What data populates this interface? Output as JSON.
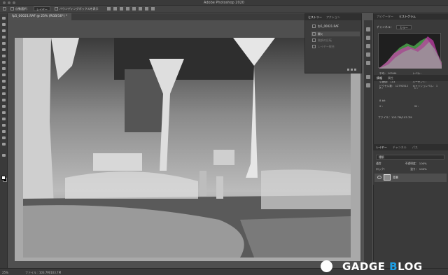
{
  "app": {
    "title": "Adobe Photoshop 2020"
  },
  "options_bar": {
    "auto_select_label": "自動選択：",
    "layer_select_value": "レイヤー",
    "bounding_box_label": "バウンディングボックスを表示"
  },
  "document": {
    "tab_title": "fp5_00021.RAF @ 25% (RGB/16*) *"
  },
  "status": {
    "zoom": "25%",
    "file_info": "ファイル : 103.7M/103.7M"
  },
  "layers_dock": {
    "tabs": [
      "ヒストリー",
      "アクション"
    ],
    "snapshot": "fp5_00021.RAF",
    "rows": [
      "開く",
      "階調の反転",
      "レイヤー統合"
    ]
  },
  "right_panel": {
    "top_tabs": [
      "ナビゲーター",
      "ヒストグラム"
    ],
    "channel_label": "チャンネル：",
    "channel_value": "カラー",
    "stats": [
      "平均：  103.64",
      "レベル：",
      "標準偏差： 61.05",
      "ピクセル数：",
      "中間値：  103",
      "パーセント：",
      "ピクセル数： 12792512",
      "キャッシュレベル： 1"
    ],
    "props_tabs": [
      "情報",
      "属性"
    ],
    "info_rows": [
      "R :",
      "C :",
      "8 bit",
      "X :",
      "W :"
    ],
    "file_label": "ファイル：103.7M/103.7M"
  },
  "layers_panel": {
    "tabs": [
      "レイヤー",
      "チャンネル",
      "パス"
    ],
    "kind_label": "種類",
    "blend_mode": "通常",
    "opacity_label": "不透明度： 100%",
    "lock_label": "ロック：",
    "fill_label": "塗り： 100%",
    "layer_name": "背景"
  },
  "watermark": {
    "part1": "GADGE ",
    "accent": "B",
    "part2": "LOG"
  },
  "colors": {
    "accent": "#1ea0e6",
    "chrome": "#3a3a3a",
    "canvas_bg": "#535353"
  },
  "icons": [
    "move-tool-icon",
    "marquee-icon",
    "lasso-icon",
    "crop-icon",
    "brush-icon",
    "eye-icon"
  ]
}
